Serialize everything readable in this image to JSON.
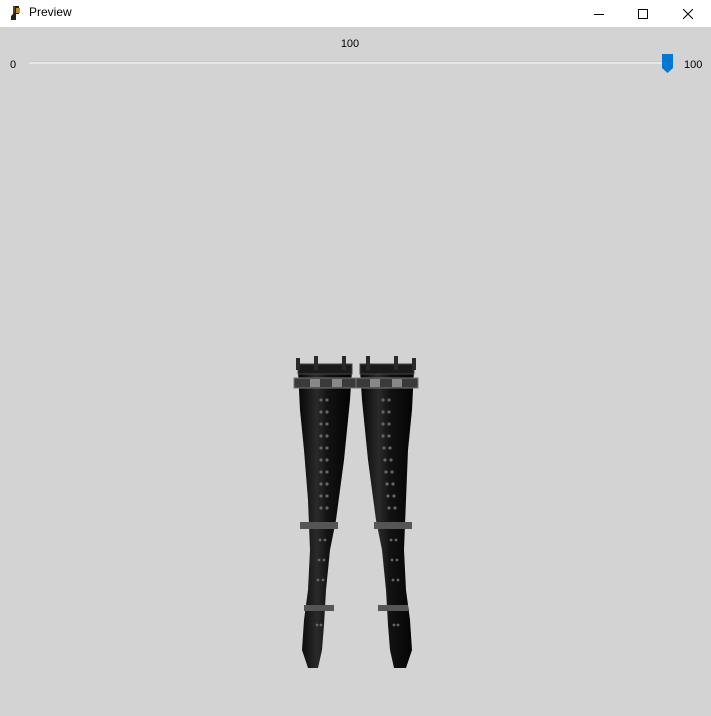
{
  "window": {
    "title": "Preview",
    "background": "#d3d3d3"
  },
  "titlebar": {
    "minimize_icon": "minimize-icon",
    "maximize_icon": "maximize-icon",
    "close_icon": "close-icon"
  },
  "slider": {
    "current_value": "100",
    "min_label": "0",
    "max_label": "100",
    "value_fraction": 1.0,
    "accent_color": "#0078d7"
  },
  "preview": {
    "content": "thigh-high lace-up boots 3D model"
  }
}
